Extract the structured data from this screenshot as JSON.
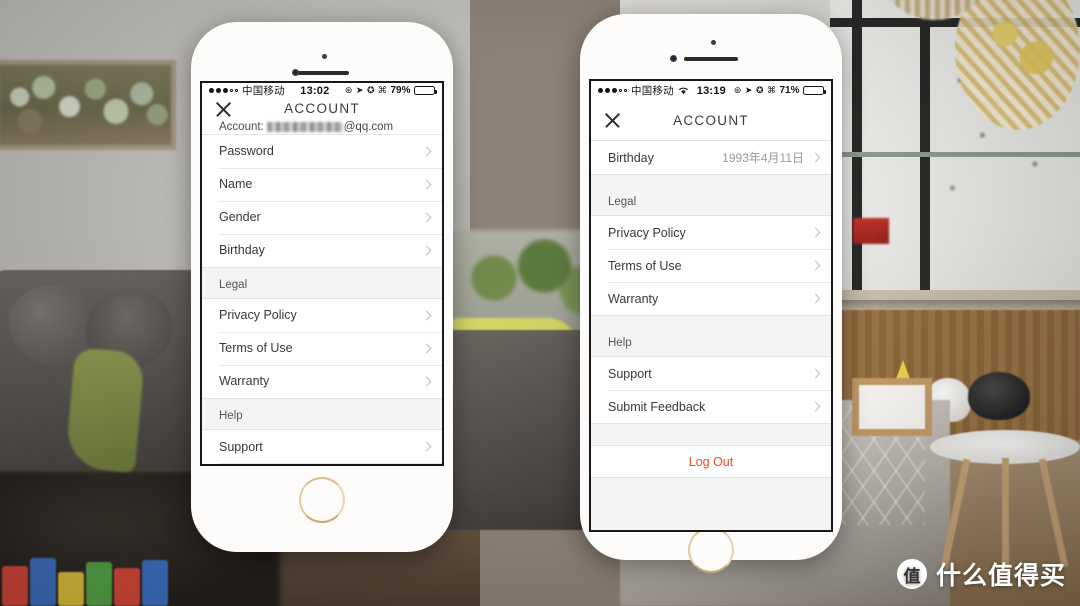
{
  "scene": {
    "description": "Two iPhones photographed in a living room, both showing an app ACCOUNT settings screen",
    "watermark": {
      "logo_glyph": "值",
      "text": "什么值得买"
    }
  },
  "phone_left": {
    "status_bar": {
      "signal_dots_filled": 3,
      "signal_dots_hollow": 2,
      "carrier": "中国移动",
      "wifi": false,
      "time": "13:02",
      "icons": [
        "alarm-icon",
        "location-icon",
        "rotation-lock-icon",
        "bluetooth-icon"
      ],
      "battery_percent": "79%",
      "battery_level": 79
    },
    "nav": {
      "close_icon": "close-icon",
      "title": "ACCOUNT"
    },
    "account": {
      "prefix": "Account:",
      "domain": "@qq.com",
      "redacted": true
    },
    "rows_primary": [
      {
        "label": "Password",
        "value": ""
      },
      {
        "label": "Name",
        "value": ""
      },
      {
        "label": "Gender",
        "value": ""
      },
      {
        "label": "Birthday",
        "value": ""
      }
    ],
    "section_legal": {
      "header": "Legal",
      "rows": [
        {
          "label": "Privacy Policy",
          "value": ""
        },
        {
          "label": "Terms of Use",
          "value": ""
        },
        {
          "label": "Warranty",
          "value": ""
        }
      ]
    },
    "section_help": {
      "header": "Help",
      "rows": [
        {
          "label": "Support",
          "value": ""
        }
      ]
    }
  },
  "phone_right": {
    "status_bar": {
      "signal_dots_filled": 3,
      "signal_dots_hollow": 2,
      "carrier": "中国移动",
      "wifi": true,
      "time": "13:19",
      "icons": [
        "alarm-icon",
        "location-icon",
        "rotation-lock-icon",
        "bluetooth-icon"
      ],
      "battery_percent": "71%",
      "battery_level": 71
    },
    "nav": {
      "close_icon": "close-icon",
      "title": "ACCOUNT"
    },
    "rows_primary": [
      {
        "label": "Birthday",
        "value": "1993年4月11日"
      }
    ],
    "section_legal": {
      "header": "Legal",
      "rows": [
        {
          "label": "Privacy Policy",
          "value": ""
        },
        {
          "label": "Terms of Use",
          "value": ""
        },
        {
          "label": "Warranty",
          "value": ""
        }
      ]
    },
    "section_help": {
      "header": "Help",
      "rows": [
        {
          "label": "Support",
          "value": ""
        },
        {
          "label": "Submit Feedback",
          "value": ""
        }
      ]
    },
    "logout": {
      "label": "Log Out",
      "color": "#f04a23"
    }
  },
  "colors": {
    "accent_logout": "#f04a23",
    "list_bg": "#ffffff",
    "group_bg": "#f4f4f4",
    "text_primary": "#35383c",
    "text_secondary": "#9a9a9a",
    "phone_gold": "#d8bd93"
  }
}
